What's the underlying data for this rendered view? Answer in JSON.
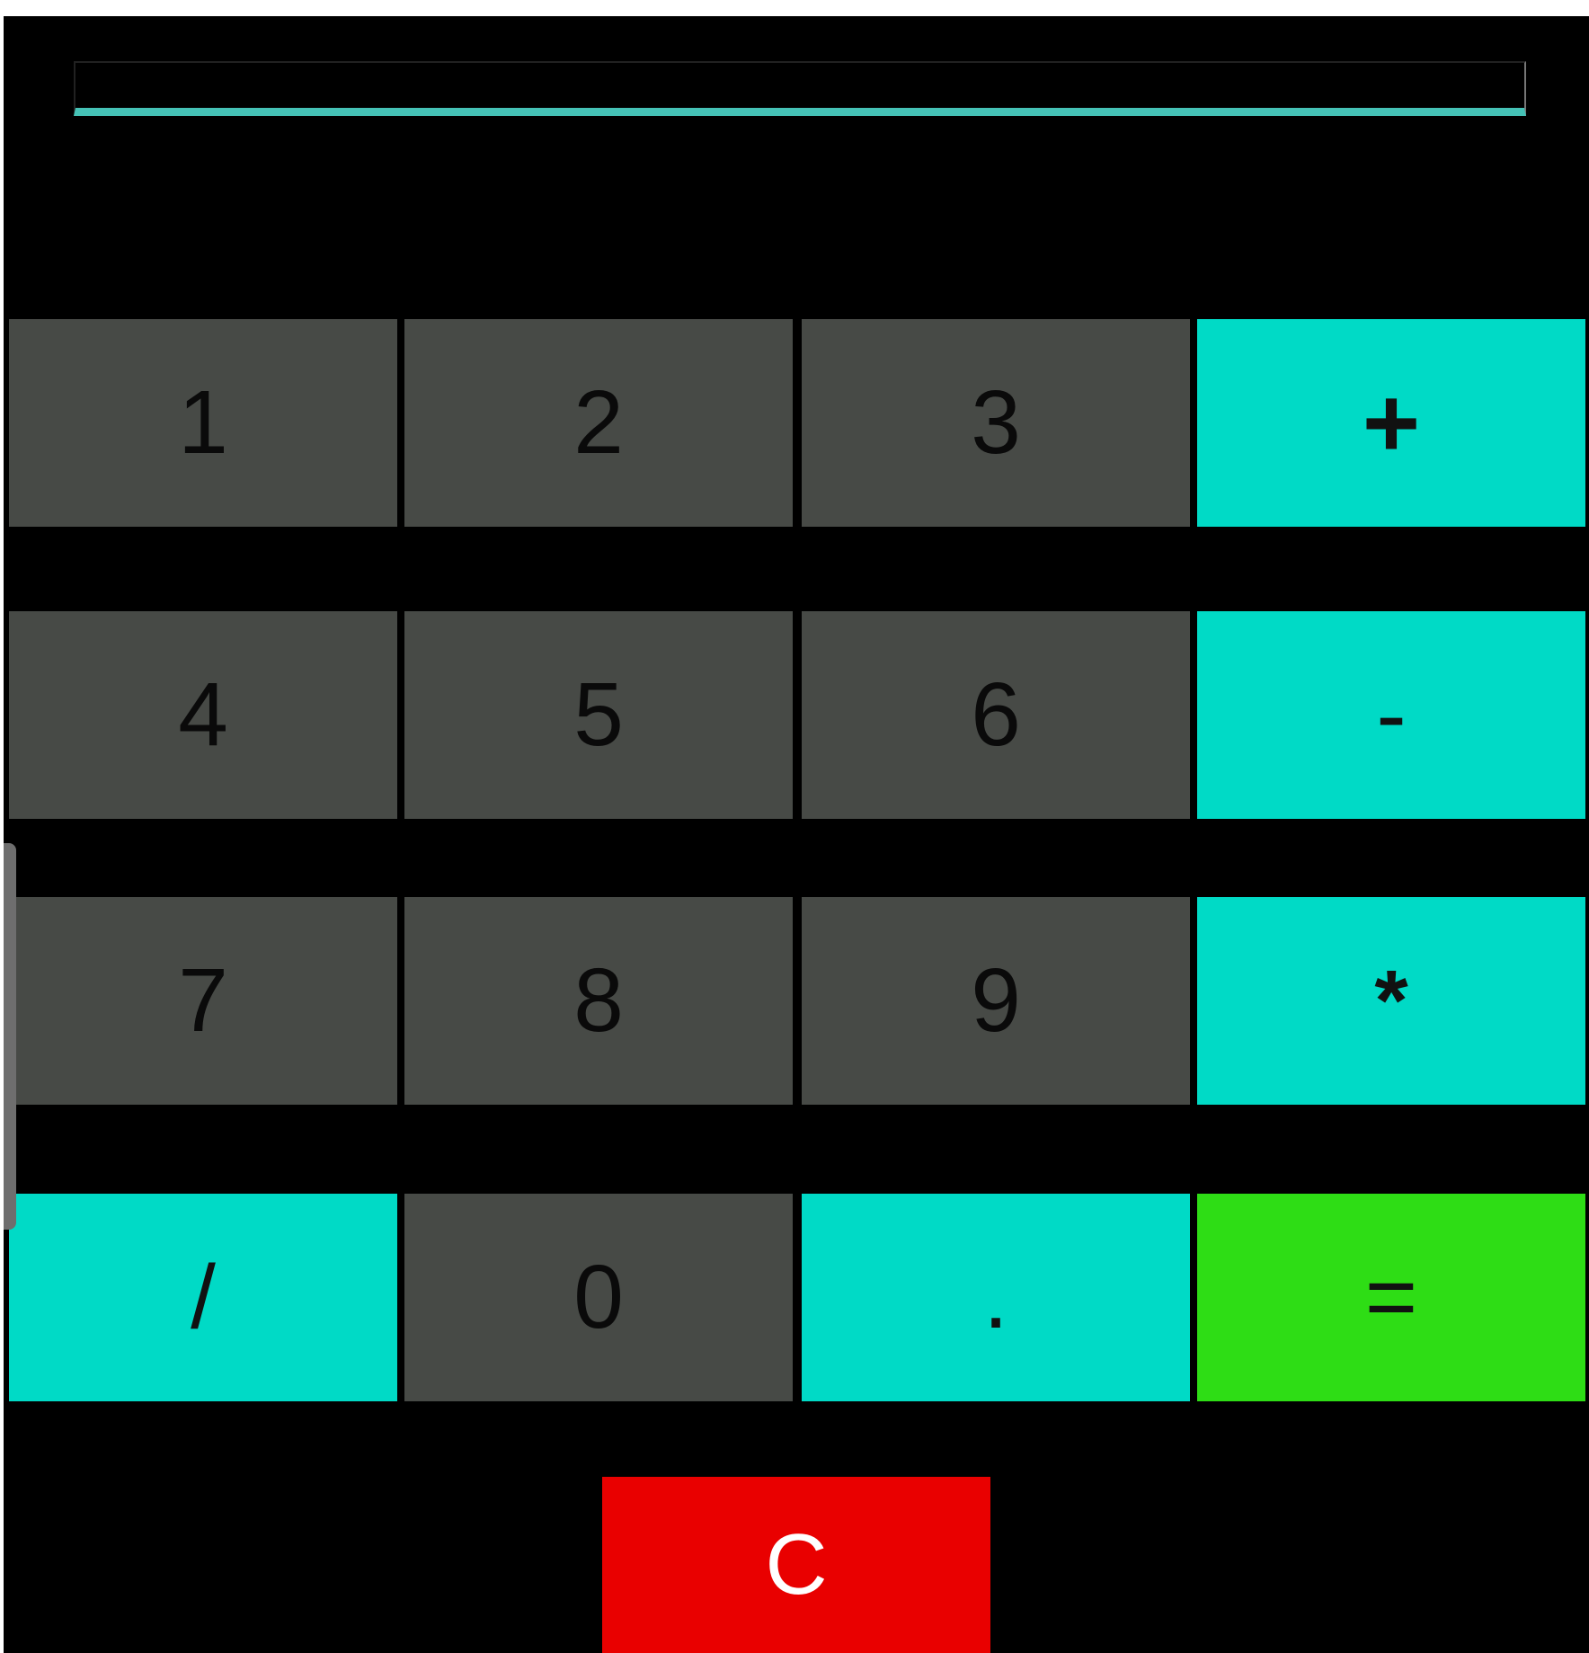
{
  "display": {
    "value": "",
    "accent_color": "#45c2b6"
  },
  "keypad": {
    "rows": [
      [
        {
          "label": "1",
          "kind": "number"
        },
        {
          "label": "2",
          "kind": "number"
        },
        {
          "label": "3",
          "kind": "number"
        },
        {
          "label": "+",
          "kind": "operator"
        }
      ],
      [
        {
          "label": "4",
          "kind": "number"
        },
        {
          "label": "5",
          "kind": "number"
        },
        {
          "label": "6",
          "kind": "number"
        },
        {
          "label": "-",
          "kind": "operator"
        }
      ],
      [
        {
          "label": "7",
          "kind": "number"
        },
        {
          "label": "8",
          "kind": "number"
        },
        {
          "label": "9",
          "kind": "number"
        },
        {
          "label": "*",
          "kind": "operator"
        }
      ],
      [
        {
          "label": "/",
          "kind": "operator"
        },
        {
          "label": "0",
          "kind": "number"
        },
        {
          "label": ".",
          "kind": "operator"
        },
        {
          "label": "=",
          "kind": "equals"
        }
      ]
    ]
  },
  "clear_button": {
    "label": "C"
  },
  "colors": {
    "background": "#000000",
    "number_key": "#474a46",
    "operator_key": "#00dac6",
    "equals_key": "#2edd15",
    "clear_key": "#e90000"
  }
}
